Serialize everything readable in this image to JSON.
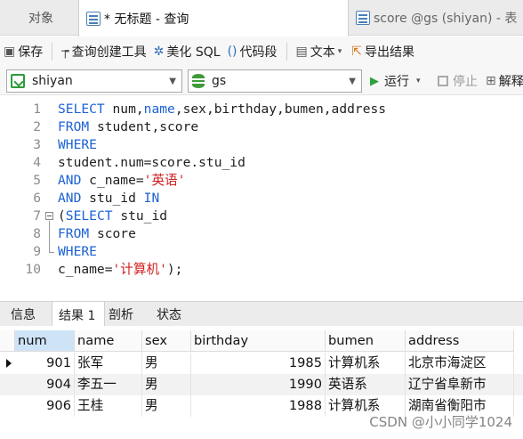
{
  "tabs": [
    {
      "label": "对象"
    },
    {
      "label": "* 无标题 - 查询"
    },
    {
      "label": "score @gs (shiyan) - 表"
    }
  ],
  "toolbar": {
    "save": "保存",
    "query_builder": "查询创建工具",
    "beautify_sql": "美化 SQL",
    "code_snippet": "代码段",
    "text": "文本",
    "export_result": "导出结果"
  },
  "connection": {
    "value": "shiyan"
  },
  "database": {
    "value": "gs"
  },
  "actions": {
    "run": "运行",
    "stop": "停止",
    "explain": "解释"
  },
  "editor": {
    "lines": [
      {
        "n": "1",
        "parts": [
          [
            "kw",
            "SELECT "
          ],
          [
            "id",
            "num,"
          ],
          [
            "kw",
            "name"
          ],
          [
            "id",
            ",sex,birthday,bumen,address"
          ]
        ]
      },
      {
        "n": "2",
        "parts": [
          [
            "kw",
            "FROM "
          ],
          [
            "id",
            "student,score"
          ]
        ]
      },
      {
        "n": "3",
        "parts": [
          [
            "kw",
            "WHERE"
          ]
        ]
      },
      {
        "n": "4",
        "parts": [
          [
            "id",
            "student.num=score.stu_id"
          ]
        ]
      },
      {
        "n": "5",
        "parts": [
          [
            "kw",
            "AND "
          ],
          [
            "id",
            "c_name="
          ],
          [
            "str",
            "'英语'"
          ]
        ]
      },
      {
        "n": "6",
        "parts": [
          [
            "kw",
            "AND "
          ],
          [
            "id",
            "stu_id "
          ],
          [
            "kw",
            "IN"
          ]
        ]
      },
      {
        "n": "7",
        "parts": [
          [
            "id",
            "("
          ],
          [
            "kw",
            "SELECT "
          ],
          [
            "id",
            "stu_id"
          ]
        ]
      },
      {
        "n": "8",
        "parts": [
          [
            "kw",
            "FROM "
          ],
          [
            "id",
            "score"
          ]
        ]
      },
      {
        "n": "9",
        "parts": [
          [
            "kw",
            "WHERE"
          ]
        ]
      },
      {
        "n": "10",
        "parts": [
          [
            "id",
            "c_name="
          ],
          [
            "str",
            "'计算机'"
          ],
          [
            "id",
            ");"
          ]
        ]
      }
    ]
  },
  "result_tabs": [
    {
      "label": "信息"
    },
    {
      "label": "结果 1"
    },
    {
      "label": "剖析"
    },
    {
      "label": "状态"
    }
  ],
  "grid": {
    "columns": [
      "num",
      "name",
      "sex",
      "birthday",
      "bumen",
      "address"
    ],
    "rows": [
      [
        "901",
        "张军",
        "男",
        "1985",
        "计算机系",
        "北京市海淀区"
      ],
      [
        "904",
        "李五一",
        "男",
        "1990",
        "英语系",
        "辽宁省阜新市"
      ],
      [
        "906",
        "王桂",
        "男",
        "1988",
        "计算机系",
        "湖南省衡阳市"
      ]
    ]
  },
  "watermark": "CSDN @小小同学1024",
  "colors": {
    "keyword": "#1b62d3",
    "string": "#d11f1f",
    "run": "#2da13a"
  }
}
